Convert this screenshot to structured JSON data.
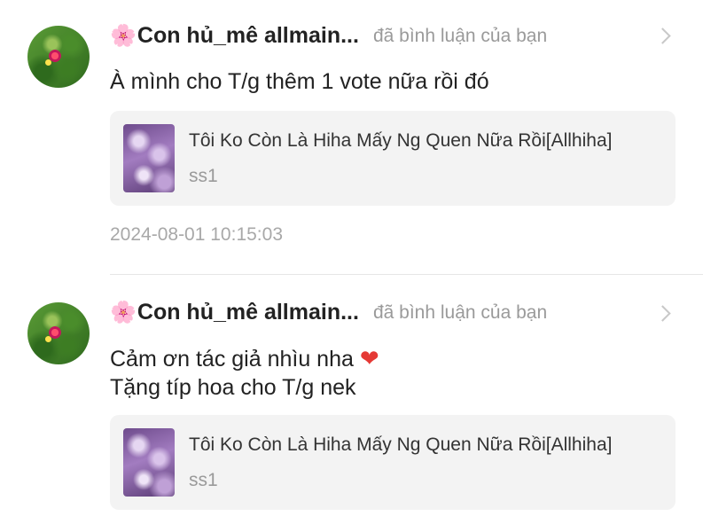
{
  "notifications": [
    {
      "username": "Con hủ_mê allmain...",
      "action": "đã bình luận của bạn",
      "comment_lines": [
        "À mình cho T/g thêm 1 vote nữa rồi đó"
      ],
      "story": {
        "title": "Tôi Ko Còn Là Hiha Mấy Ng Quen Nữa Rồi[Allhiha]",
        "subtitle": "ss1"
      },
      "timestamp": "2024-08-01 10:15:03"
    },
    {
      "username": "Con hủ_mê allmain...",
      "action": "đã bình luận của bạn",
      "comment_lines": [
        "Cảm ơn tác giả nhìu nha",
        "Tặng típ hoa cho T/g nek"
      ],
      "heart": "❤",
      "story": {
        "title": "Tôi Ko Còn Là Hiha Mấy Ng Quen Nữa Rồi[Allhiha]",
        "subtitle": "ss1"
      }
    }
  ],
  "icons": {
    "blossom": "🌸",
    "chevron": "chevron-right-icon"
  }
}
